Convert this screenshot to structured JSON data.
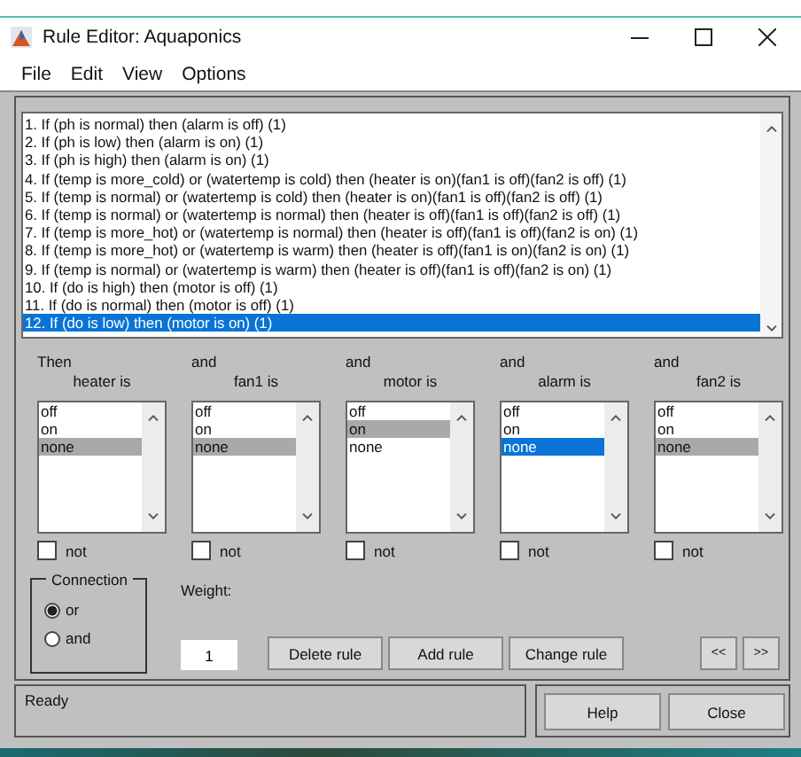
{
  "window": {
    "title": "Rule Editor: Aquaponics"
  },
  "menu": [
    "File",
    "Edit",
    "View",
    "Options"
  ],
  "rules": [
    {
      "text": "1. If (ph is normal) then (alarm is off) (1)",
      "selected": false
    },
    {
      "text": "2. If (ph is low) then (alarm is on) (1)",
      "selected": false
    },
    {
      "text": "3. If (ph is high) then (alarm is on) (1)",
      "selected": false
    },
    {
      "text": "4. If (temp is more_cold) or (watertemp is cold) then (heater is on)(fan1 is off)(fan2 is off) (1)",
      "selected": false
    },
    {
      "text": "5. If (temp is normal) or (watertemp is cold) then (heater is on)(fan1 is off)(fan2 is off) (1)",
      "selected": false
    },
    {
      "text": "6. If (temp is normal) or (watertemp is normal) then (heater is off)(fan1 is off)(fan2 is off) (1)",
      "selected": false
    },
    {
      "text": "7. If (temp is more_hot) or (watertemp is normal) then (heater is off)(fan1 is off)(fan2 is on) (1)",
      "selected": false
    },
    {
      "text": "8. If (temp is more_hot) or (watertemp is warm) then (heater is off)(fan1 is on)(fan2 is on) (1)",
      "selected": false
    },
    {
      "text": "9. If (temp is normal) or (watertemp is warm) then (heater is off)(fan1 is off)(fan2 is on) (1)",
      "selected": false
    },
    {
      "text": "10. If (do is high) then (motor is off) (1)",
      "selected": false
    },
    {
      "text": "11. If (do is normal) then (motor is off) (1)",
      "selected": false
    },
    {
      "text": "12. If (do is low) then (motor is on) (1)",
      "selected": true
    }
  ],
  "outputs": [
    {
      "connector": "Then",
      "label": "heater is",
      "focused": false,
      "not_label": "not",
      "not_checked": false,
      "options": [
        {
          "text": "off",
          "selected": false
        },
        {
          "text": "on",
          "selected": false
        },
        {
          "text": "none",
          "selected": true
        }
      ]
    },
    {
      "connector": "and",
      "label": "fan1 is",
      "focused": false,
      "not_label": "not",
      "not_checked": false,
      "options": [
        {
          "text": "off",
          "selected": false
        },
        {
          "text": "on",
          "selected": false
        },
        {
          "text": "none",
          "selected": true
        }
      ]
    },
    {
      "connector": "and",
      "label": "motor is",
      "focused": false,
      "not_label": "not",
      "not_checked": false,
      "options": [
        {
          "text": "off",
          "selected": false
        },
        {
          "text": "on",
          "selected": true
        },
        {
          "text": "none",
          "selected": false
        }
      ]
    },
    {
      "connector": "and",
      "label": "alarm is",
      "focused": true,
      "not_label": "not",
      "not_checked": false,
      "options": [
        {
          "text": "off",
          "selected": false
        },
        {
          "text": "on",
          "selected": false
        },
        {
          "text": "none",
          "selected": true
        }
      ]
    },
    {
      "connector": "and",
      "label": "fan2 is",
      "focused": false,
      "not_label": "not",
      "not_checked": false,
      "options": [
        {
          "text": "off",
          "selected": false
        },
        {
          "text": "on",
          "selected": false
        },
        {
          "text": "none",
          "selected": true
        }
      ]
    }
  ],
  "connection": {
    "title": "Connection",
    "options": [
      {
        "label": "or",
        "selected": true
      },
      {
        "label": "and",
        "selected": false
      }
    ]
  },
  "weight": {
    "label": "Weight:",
    "value": "1"
  },
  "buttons": [
    "Delete rule",
    "Add rule",
    "Change rule"
  ],
  "nav_buttons": [
    "<<",
    ">>"
  ],
  "status_bar": "Ready",
  "footer_buttons": [
    "Help",
    "Close"
  ]
}
